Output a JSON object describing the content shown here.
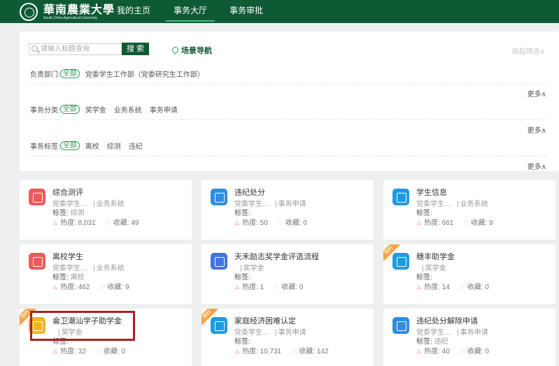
{
  "header": {
    "logo_cn": "華南農業大學",
    "logo_en": "South China Agricultural University",
    "nav": [
      "我的主页",
      "事务大厅",
      "事务审批"
    ]
  },
  "filter": {
    "search_placeholder": "请输入标题查询",
    "search_button": "搜 索",
    "scene_nav": "场景导航",
    "collapse": "收起筛选∧",
    "rows": [
      {
        "label": "负责部门:",
        "all": "全部",
        "options": [
          "党委学生工作部（党委研究生工作部）"
        ]
      },
      {
        "label": "事务分类:",
        "all": "全部",
        "options": [
          "奖学金",
          "业务系统",
          "事务申请"
        ]
      },
      {
        "label": "事务标签:",
        "all": "全部",
        "options": [
          "离校",
          "综测",
          "违纪"
        ]
      }
    ],
    "more": "更多∧"
  },
  "cards": [
    {
      "title": "综合测评",
      "dept": "党委学生…",
      "category": "业务系统",
      "tag_label": "标签:",
      "tag": "综测",
      "heat_label": "热度:",
      "heat": "8,031",
      "fav_label": "收藏:",
      "fav": "49",
      "icon": "chart-icon",
      "color": "#ee5a5a"
    },
    {
      "title": "违纪处分",
      "dept": "党委学生…",
      "category": "事务申请",
      "tag_label": "标签:",
      "tag": "",
      "heat_label": "热度:",
      "heat": "50",
      "fav_label": "收藏:",
      "fav": "0",
      "icon": "document-icon",
      "color": "#2f8de2"
    },
    {
      "title": "学生信息",
      "dept": "党委学生…",
      "category": "业务系统",
      "tag_label": "标签:",
      "tag": "",
      "heat_label": "热度:",
      "heat": "661",
      "fav_label": "收藏:",
      "fav": "9",
      "icon": "graduation-cap-icon",
      "color": "#1e9be0"
    },
    {
      "title": "离校学生",
      "dept": "党委学生…",
      "category": "业务系统",
      "tag_label": "标签:",
      "tag": "离校",
      "heat_label": "热度:",
      "heat": "462",
      "fav_label": "收藏:",
      "fav": "9",
      "icon": "user-icon",
      "color": "#ee5a5a"
    },
    {
      "title": "天禾励志奖学金评选流程",
      "dept": "",
      "category": "奖学金",
      "tag_label": "标签:",
      "tag": "",
      "heat_label": "热度:",
      "heat": "1",
      "fav_label": "收藏:",
      "fav": "0",
      "icon": "flag-icon",
      "color": "#3f74e0"
    },
    {
      "title": "穗丰助学金",
      "dept": "",
      "category": "奖学金",
      "tag_label": "标签:",
      "tag": "",
      "heat_label": "热度:",
      "heat": "14",
      "fav_label": "收藏:",
      "fav": "0",
      "icon": "award-icon",
      "color": "#1e9be0",
      "ribbon": "限时"
    },
    {
      "title": "侖卫潮汕学子助学金",
      "dept": "",
      "category": "奖学金",
      "tag_label": "标签:",
      "tag": "",
      "heat_label": "热度:",
      "heat": "32",
      "fav_label": "收藏:",
      "fav": "0",
      "icon": "calculator-icon",
      "color": "#f2b51c",
      "ribbon": "限时"
    },
    {
      "title": "家庭经济困难认定",
      "dept": "党委学生…",
      "category": "事务申请",
      "tag_label": "标签:",
      "tag": "",
      "heat_label": "热度:",
      "heat": "10,731",
      "fav_label": "收藏:",
      "fav": "142",
      "icon": "person-home-icon",
      "color": "#1e9be0",
      "ribbon": "限时"
    },
    {
      "title": "违纪处分解除申请",
      "dept": "党委学生…",
      "category": "事务申请",
      "tag_label": "标签:",
      "tag": "违纪",
      "heat_label": "热度:",
      "heat": "40",
      "fav_label": "收藏:",
      "fav": "0",
      "icon": "form-icon",
      "color": "#2f8de2"
    }
  ]
}
